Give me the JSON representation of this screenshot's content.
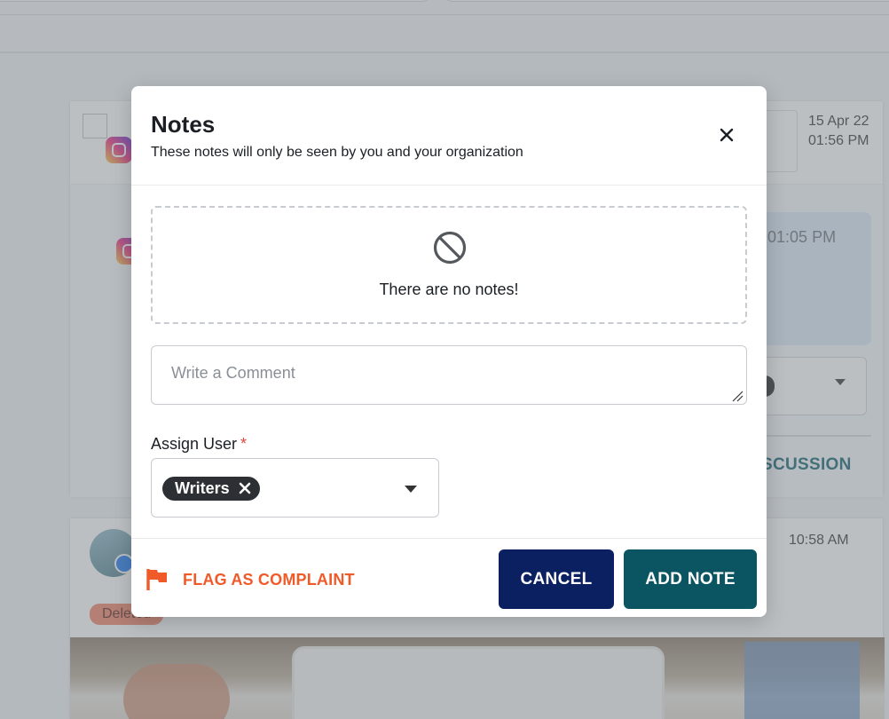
{
  "background": {
    "card1": {
      "timestamp_line1": "15 Apr 22",
      "timestamp_line2": "01:56 PM",
      "message_time": "22 01:05 PM",
      "discussion_label": "SCUSSION"
    },
    "card2": {
      "timestamp": "10:58 AM",
      "status_badge": "Deleted"
    }
  },
  "modal": {
    "title": "Notes",
    "subtitle": "These notes will only be seen by you and your organization",
    "empty_state": {
      "icon": "ban-icon",
      "text": "There are no notes!"
    },
    "comment": {
      "placeholder": "Write a Comment",
      "value": ""
    },
    "assign_user": {
      "label": "Assign User",
      "required_marker": "*",
      "selected_chip": "Writers"
    },
    "footer": {
      "flag_label": "FLAG AS COMPLAINT",
      "cancel_label": "CANCEL",
      "add_note_label": "ADD NOTE"
    }
  },
  "colors": {
    "flag_orange": "#f05a28",
    "cancel_navy": "#0b2060",
    "add_note_teal": "#0b5563",
    "chip_dark": "#2c2f33",
    "required_red": "#e0453a"
  }
}
